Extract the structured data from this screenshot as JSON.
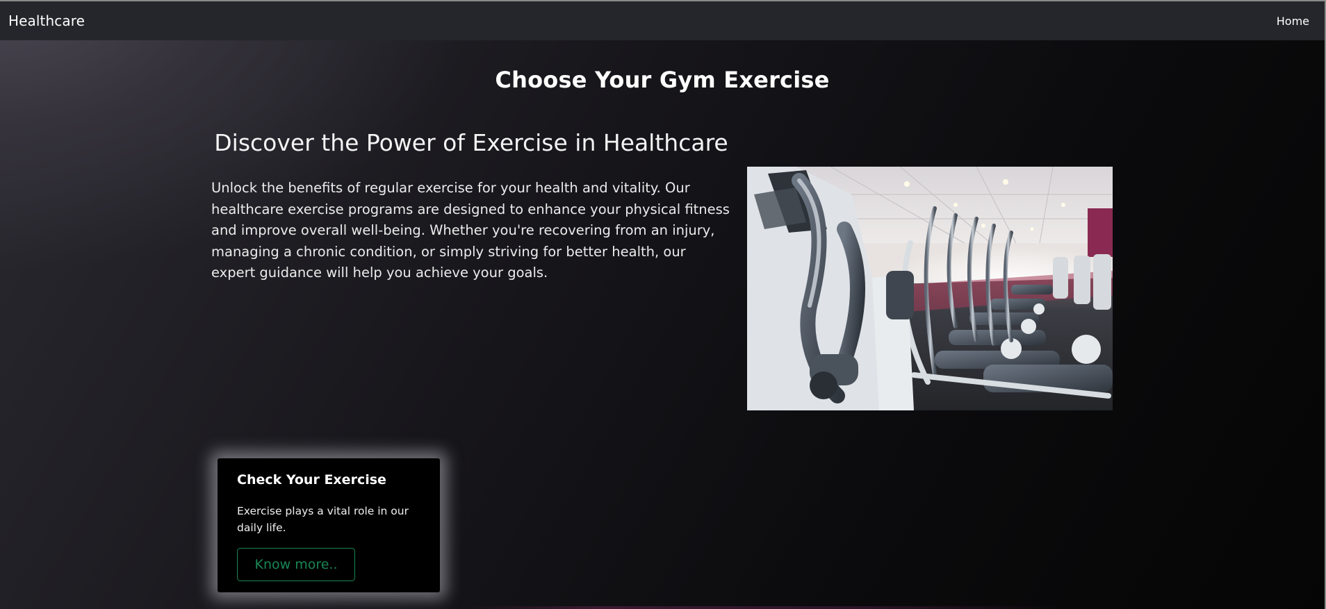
{
  "navbar": {
    "brand": "Healthcare",
    "links": [
      {
        "label": "Home"
      }
    ]
  },
  "page": {
    "title": "Choose Your Gym Exercise"
  },
  "intro": {
    "heading": "Discover the Power of Exercise in Healthcare",
    "paragraph": "Unlock the benefits of regular exercise for your health and vitality. Our healthcare exercise programs are designed to enhance your physical fitness and improve overall well-being. Whether you're recovering from an injury, managing a chronic condition, or simply striving for better health, our expert guidance will help you achieve your goals."
  },
  "card": {
    "title": "Check Your Exercise",
    "text": "Exercise plays a vital role in our daily life.",
    "button_label": "Know more.."
  },
  "colors": {
    "navbar_bg": "#24262b",
    "button_accent": "#198754",
    "card_bg": "#000000"
  }
}
